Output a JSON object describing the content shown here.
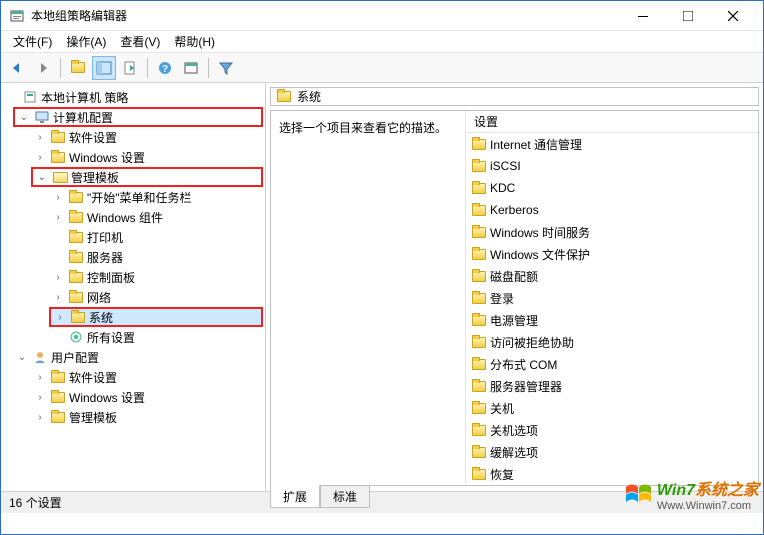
{
  "window": {
    "title": "本地组策略编辑器"
  },
  "menu": {
    "file": "文件(F)",
    "action": "操作(A)",
    "view": "查看(V)",
    "help": "帮助(H)"
  },
  "tree": {
    "root": "本地计算机 策略",
    "computer_cfg": "计算机配置",
    "software_settings": "软件设置",
    "windows_settings": "Windows 设置",
    "admin_templates": "管理模板",
    "start_menu": "\"开始\"菜单和任务栏",
    "windows_components": "Windows 组件",
    "printers": "打印机",
    "servers": "服务器",
    "control_panel": "控制面板",
    "network": "网络",
    "system": "系统",
    "all_settings": "所有设置",
    "user_cfg": "用户配置",
    "u_software": "软件设置",
    "u_windows": "Windows 设置",
    "u_admin": "管理模板"
  },
  "details": {
    "section_title": "系统",
    "description": "选择一个项目来查看它的描述。",
    "column_header": "设置"
  },
  "list_items": [
    "Internet 通信管理",
    "iSCSI",
    "KDC",
    "Kerberos",
    "Windows 时间服务",
    "Windows 文件保护",
    "磁盘配额",
    "登录",
    "电源管理",
    "访问被拒绝协助",
    "分布式 COM",
    "服务器管理器",
    "关机",
    "关机选项",
    "缓解选项",
    "恢复"
  ],
  "tabs": {
    "extended": "扩展",
    "standard": "标准"
  },
  "status": "16 个设置",
  "watermark": {
    "brand1": "Win7",
    "brand2": "系统之家",
    "url": "Www.Winwin7.com"
  }
}
